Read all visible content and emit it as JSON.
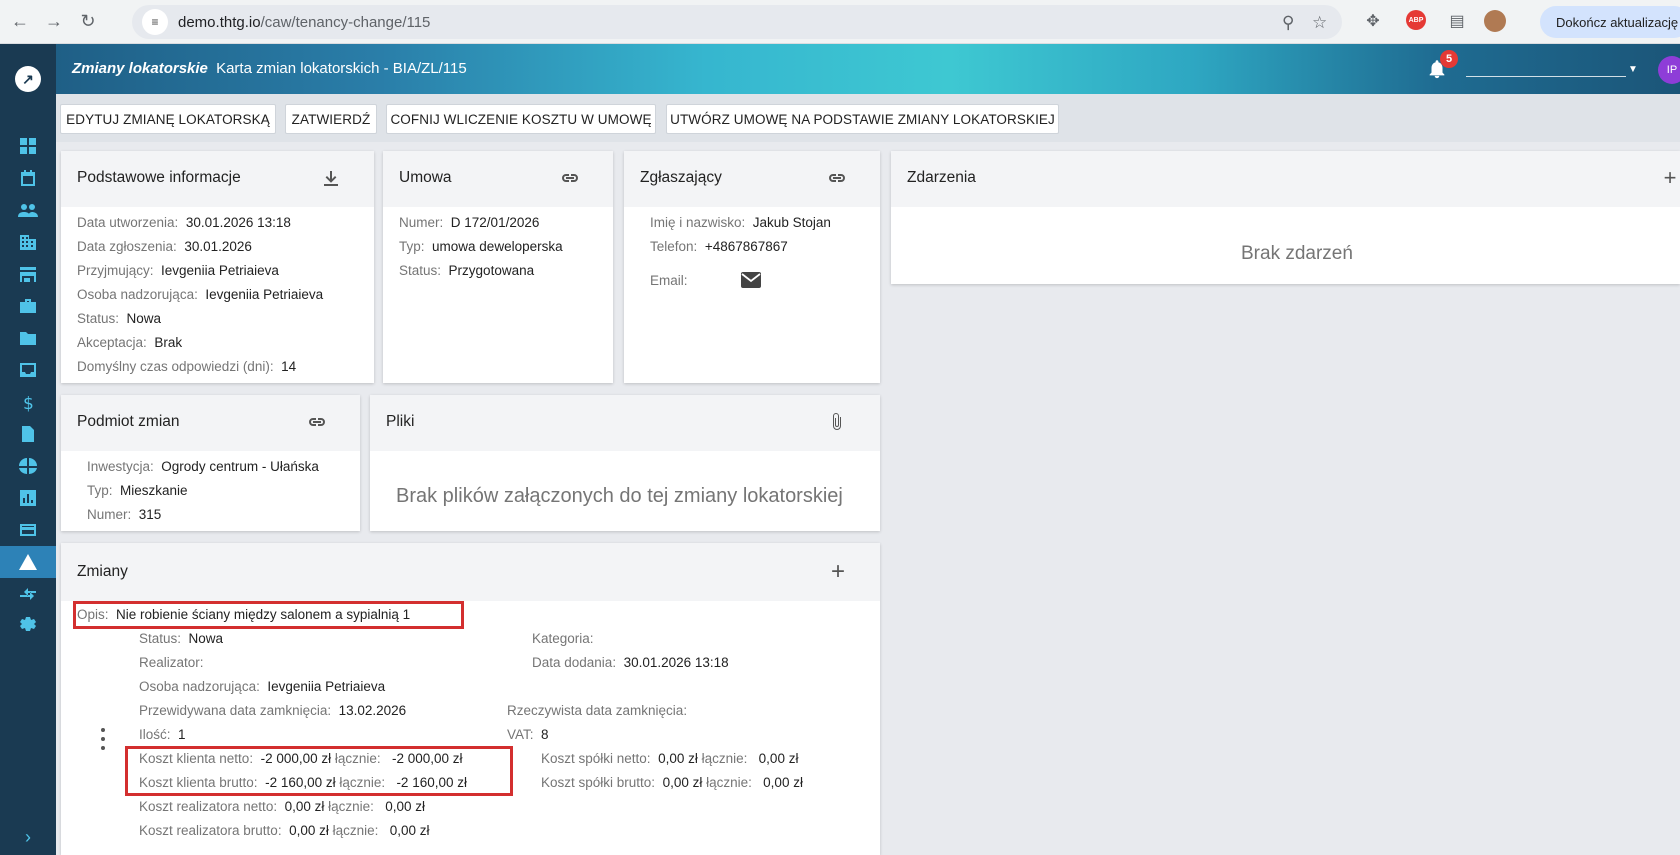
{
  "browser": {
    "url_host": "demo.thtg.io",
    "url_path": "/caw/tenancy-change/115",
    "update_label": "Dokończ aktualizację",
    "abp_label": "ABP"
  },
  "header": {
    "breadcrumb_root": "Zmiany lokatorskie",
    "breadcrumb_current": "Karta zmian lokatorskich - BIA/ZL/115",
    "notifications_count": "5",
    "avatar_initials": "IP"
  },
  "toolbar": {
    "edit_label": "EDYTUJ ZMIANĘ LOKATORSKĄ",
    "approve_label": "ZATWIERDŹ",
    "revert_label": "COFNIJ WLICZENIE KOSZTU W UMOWĘ",
    "create_contract_label": "UTWÓRZ UMOWĘ NA PODSTAWIE ZMIANY LOKATORSKIEJ"
  },
  "basic_info": {
    "title": "Podstawowe informacje",
    "fields": [
      {
        "k": "Data utworzenia:",
        "v": "30.01.2026 13:18"
      },
      {
        "k": "Data zgłoszenia:",
        "v": "30.01.2026"
      },
      {
        "k": "Przyjmujący:",
        "v": "Ievgeniia Petriaieva"
      },
      {
        "k": "Osoba nadzorująca:",
        "v": "Ievgeniia Petriaieva"
      },
      {
        "k": "Status:",
        "v": "Nowa"
      },
      {
        "k": "Akceptacja:",
        "v": "Brak"
      },
      {
        "k": "Domyślny czas odpowiedzi (dni):",
        "v": "14"
      }
    ]
  },
  "contract": {
    "title": "Umowa",
    "fields": [
      {
        "k": "Numer:",
        "v": "D 172/01/2026"
      },
      {
        "k": "Typ:",
        "v": "umowa deweloperska"
      },
      {
        "k": "Status:",
        "v": "Przygotowana"
      }
    ]
  },
  "reporter": {
    "title": "Zgłaszający",
    "fields": [
      {
        "k": "Imię i nazwisko:",
        "v": "Jakub Stojan"
      },
      {
        "k": "Telefon:",
        "v": "+4867867867"
      },
      {
        "k": "Email:",
        "v": ""
      }
    ]
  },
  "events": {
    "title": "Zdarzenia",
    "empty": "Brak zdarzeń"
  },
  "subject": {
    "title": "Podmiot zmian",
    "fields": [
      {
        "k": "Inwestycja:",
        "v": "Ogrody centrum - Ułańska"
      },
      {
        "k": "Typ:",
        "v": "Mieszkanie"
      },
      {
        "k": "Numer:",
        "v": "315"
      }
    ]
  },
  "files": {
    "title": "Pliki",
    "empty": "Brak plików załączonych do tej zmiany lokatorskiej"
  },
  "changes": {
    "title": "Zmiany",
    "desc_k": "Opis:",
    "desc_v": "Nie robienie ściany między salonem a sypialnią 1",
    "status_k": "Status:",
    "status_v": "Nowa",
    "category_k": "Kategoria:",
    "category_v": "",
    "realizer_k": "Realizator:",
    "realizer_v": "",
    "added_k": "Data dodania:",
    "added_v": "30.01.2026 13:18",
    "supervisor_k": "Osoba nadzorująca:",
    "supervisor_v": "Ievgeniia Petriaieva",
    "planned_close_k": "Przewidywana data zamknięcia:",
    "planned_close_v": "13.02.2026",
    "actual_close_k": "Rzeczywista data zamknięcia:",
    "actual_close_v": "",
    "qty_k": "Ilość:",
    "qty_v": "1",
    "vat_k": "VAT:",
    "vat_v": "8",
    "total_k": "łącznie:",
    "client_net_k": "Koszt klienta netto:",
    "client_net_v": "-2 000,00 zł",
    "client_net_total": "-2 000,00 zł",
    "client_gross_k": "Koszt klienta brutto:",
    "client_gross_v": "-2 160,00 zł",
    "client_gross_total": "-2 160,00 zł",
    "company_net_k": "Koszt spółki netto:",
    "company_net_v": "0,00 zł",
    "company_net_total": "0,00 zł",
    "company_gross_k": "Koszt spółki brutto:",
    "company_gross_v": "0,00 zł",
    "company_gross_total": "0,00 zł",
    "realizer_net_k": "Koszt realizatora netto:",
    "realizer_net_v": "0,00 zł",
    "realizer_net_total": "0,00 zł",
    "realizer_gross_k": "Koszt realizatora brutto:",
    "realizer_gross_v": "0,00 zł",
    "realizer_gross_total": "0,00 zł"
  }
}
